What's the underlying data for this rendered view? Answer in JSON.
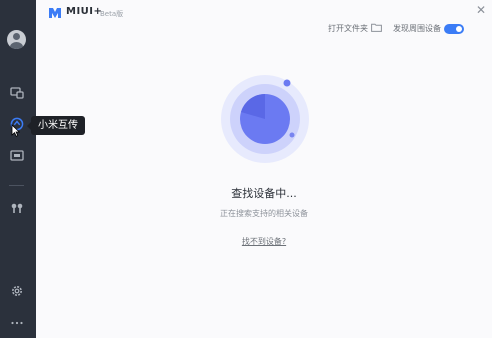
{
  "app": {
    "name": "MIUI+",
    "badge": "Beta版"
  },
  "sidebar": {
    "items": [
      {
        "icon": "devices-icon"
      },
      {
        "icon": "xiaomi-share-icon",
        "tooltip": "小米互传"
      },
      {
        "icon": "screen-cast-icon"
      },
      {
        "icon": "earbuds-icon"
      }
    ],
    "settings_icon": "gear-icon",
    "more_icon": "more-dots-icon"
  },
  "toolbar": {
    "open_folder_label": "打开文件夹",
    "discover_label": "发现周围设备",
    "discover_enabled": true
  },
  "main": {
    "status_title": "查找设备中...",
    "status_subtitle": "正在搜索支持的相关设备",
    "help_link": "找不到设备?"
  },
  "colors": {
    "accent": "#3b7cf6",
    "radar": "#6b7af2",
    "sidebar": "#2b313c"
  }
}
